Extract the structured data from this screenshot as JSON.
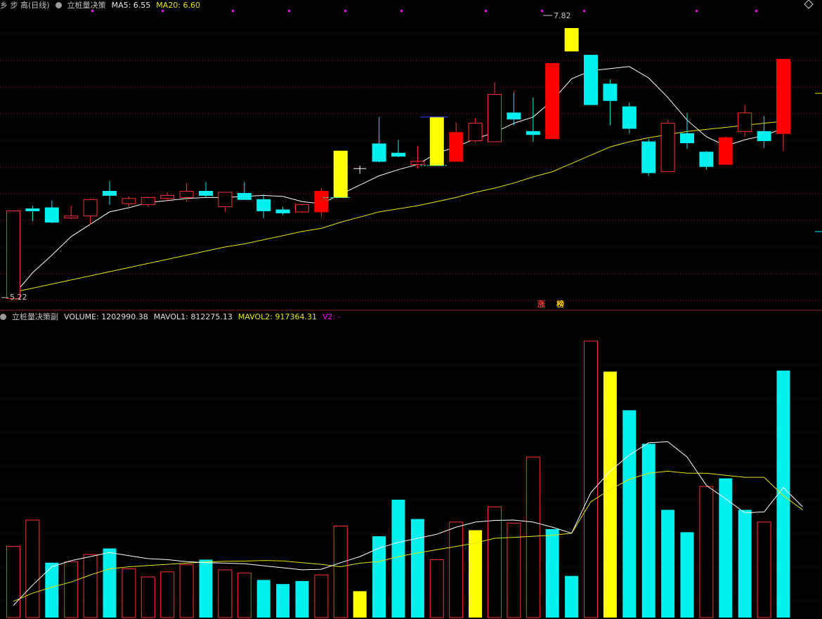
{
  "colors": {
    "background": "#000000",
    "grid": "#8b1a1a",
    "up": "#ff3232",
    "up_fill": "#ff0000",
    "down": "#00f0f0",
    "signal": "#ffff00",
    "ma5": "#ffffff",
    "ma20": "#e6e600",
    "v2": "#ff00ff",
    "header_text": "#c0c0c0",
    "zhang_text": "#ff3333",
    "bang_text": "#ffcc00"
  },
  "header_top": {
    "prefix": "乡 步 高(日线)",
    "indicator": "立桩量决策",
    "ma5_label": "MA5: 6.55",
    "ma20_label": "MA20: 6.60"
  },
  "header_bottom": {
    "indicator": "立桩量决策副",
    "volume_label": "VOLUME: 1202990.38",
    "mavol1_label": "MAVOL1: 812275.13",
    "mavol2_label": "MAVOL2: 917364.31",
    "v2_label": "V2: -"
  },
  "markers": {
    "zhang": "涨",
    "bang": "榜",
    "high_label": "7.82",
    "low_label": "5.22"
  },
  "chart_data": [
    {
      "type": "candlestick",
      "title": "立桩量决策",
      "series_note": "daily OHLC, price axis range approx 5.1 to 8.0",
      "ylim": [
        5.1,
        8.0
      ],
      "candles": [
        {
          "o": 5.2,
          "h": 6.05,
          "l": 5.22,
          "c": 6.05,
          "k": "up"
        },
        {
          "o": 6.07,
          "h": 6.1,
          "l": 5.95,
          "c": 6.05,
          "k": "down"
        },
        {
          "o": 6.08,
          "h": 6.15,
          "l": 5.93,
          "c": 5.94,
          "k": "down"
        },
        {
          "o": 5.98,
          "h": 6.1,
          "l": 5.97,
          "c": 6.0,
          "k": "up"
        },
        {
          "o": 6.0,
          "h": 6.17,
          "l": 5.92,
          "c": 6.16,
          "k": "up"
        },
        {
          "o": 6.2,
          "h": 6.34,
          "l": 6.11,
          "c": 6.24,
          "k": "down"
        },
        {
          "o": 6.12,
          "h": 6.19,
          "l": 6.09,
          "c": 6.17,
          "k": "up"
        },
        {
          "o": 6.11,
          "h": 6.19,
          "l": 6.09,
          "c": 6.18,
          "k": "up"
        },
        {
          "o": 6.17,
          "h": 6.23,
          "l": 6.14,
          "c": 6.2,
          "k": "up"
        },
        {
          "o": 6.18,
          "h": 6.32,
          "l": 6.14,
          "c": 6.24,
          "k": "up"
        },
        {
          "o": 6.24,
          "h": 6.33,
          "l": 6.18,
          "c": 6.2,
          "k": "down"
        },
        {
          "o": 6.09,
          "h": 6.22,
          "l": 6.04,
          "c": 6.23,
          "k": "up"
        },
        {
          "o": 6.22,
          "h": 6.33,
          "l": 6.18,
          "c": 6.16,
          "k": "down"
        },
        {
          "o": 6.16,
          "h": 6.21,
          "l": 5.98,
          "c": 6.05,
          "k": "down"
        },
        {
          "o": 6.06,
          "h": 6.09,
          "l": 6.01,
          "c": 6.03,
          "k": "down"
        },
        {
          "o": 6.04,
          "h": 6.12,
          "l": 6.03,
          "c": 6.11,
          "k": "up"
        },
        {
          "o": 6.04,
          "h": 6.27,
          "l": 5.99,
          "c": 6.24,
          "k": "upfill"
        },
        {
          "o": 6.18,
          "h": 6.63,
          "l": 6.18,
          "c": 6.63,
          "k": "signal"
        },
        {
          "o": 6.46,
          "h": 6.49,
          "l": 6.41,
          "c": 6.46,
          "k": "cross"
        },
        {
          "o": 6.7,
          "h": 6.96,
          "l": 6.52,
          "c": 6.53,
          "k": "down"
        },
        {
          "o": 6.61,
          "h": 6.74,
          "l": 6.57,
          "c": 6.58,
          "k": "down"
        },
        {
          "o": 6.5,
          "h": 6.68,
          "l": 6.46,
          "c": 6.53,
          "k": "up"
        },
        {
          "o": 6.49,
          "h": 6.96,
          "l": 6.49,
          "c": 6.96,
          "k": "signal"
        },
        {
          "o": 6.53,
          "h": 6.91,
          "l": 6.53,
          "c": 6.81,
          "k": "upfill"
        },
        {
          "o": 6.73,
          "h": 6.95,
          "l": 6.71,
          "c": 6.9,
          "k": "up"
        },
        {
          "o": 6.72,
          "h": 7.3,
          "l": 6.72,
          "c": 7.18,
          "k": "up"
        },
        {
          "o": 7.0,
          "h": 7.2,
          "l": 6.88,
          "c": 6.94,
          "k": "down"
        },
        {
          "o": 6.82,
          "h": 7.15,
          "l": 6.72,
          "c": 6.79,
          "k": "down"
        },
        {
          "o": 6.75,
          "h": 7.48,
          "l": 6.75,
          "c": 7.48,
          "k": "upfill"
        },
        {
          "o": 7.6,
          "h": 7.82,
          "l": 7.6,
          "c": 7.82,
          "k": "signal"
        },
        {
          "o": 7.56,
          "h": 7.56,
          "l": 7.08,
          "c": 7.08,
          "k": "down"
        },
        {
          "o": 7.28,
          "h": 7.32,
          "l": 6.88,
          "c": 7.12,
          "k": "down"
        },
        {
          "o": 7.06,
          "h": 7.1,
          "l": 6.8,
          "c": 6.85,
          "k": "down"
        },
        {
          "o": 6.72,
          "h": 6.75,
          "l": 6.39,
          "c": 6.42,
          "k": "down"
        },
        {
          "o": 6.43,
          "h": 6.93,
          "l": 6.43,
          "c": 6.9,
          "k": "up"
        },
        {
          "o": 6.8,
          "h": 7.0,
          "l": 6.65,
          "c": 6.71,
          "k": "down"
        },
        {
          "o": 6.62,
          "h": 6.63,
          "l": 6.45,
          "c": 6.48,
          "k": "down"
        },
        {
          "o": 6.5,
          "h": 6.77,
          "l": 6.5,
          "c": 6.76,
          "k": "upfill"
        },
        {
          "o": 6.82,
          "h": 7.08,
          "l": 6.77,
          "c": 7.0,
          "k": "up"
        },
        {
          "o": 6.82,
          "h": 6.97,
          "l": 6.66,
          "c": 6.73,
          "k": "down"
        },
        {
          "o": 6.8,
          "h": 7.52,
          "l": 6.63,
          "c": 7.52,
          "k": "upfill"
        }
      ],
      "ma5": [
        5.23,
        5.45,
        5.62,
        5.8,
        5.92,
        6.04,
        6.08,
        6.13,
        6.15,
        6.17,
        6.18,
        6.18,
        6.19,
        6.2,
        6.19,
        6.14,
        6.12,
        6.21,
        6.3,
        6.39,
        6.45,
        6.5,
        6.61,
        6.67,
        6.75,
        6.81,
        6.9,
        6.96,
        7.12,
        7.33,
        7.41,
        7.43,
        7.45,
        7.34,
        7.15,
        6.93,
        6.77,
        6.68,
        6.74,
        6.78,
        6.85
      ],
      "ma20": [
        5.26,
        5.3,
        5.34,
        5.38,
        5.42,
        5.46,
        5.5,
        5.54,
        5.58,
        5.62,
        5.66,
        5.7,
        5.73,
        5.77,
        5.81,
        5.85,
        5.88,
        5.94,
        5.99,
        6.04,
        6.07,
        6.1,
        6.14,
        6.18,
        6.23,
        6.27,
        6.32,
        6.38,
        6.43,
        6.51,
        6.59,
        6.67,
        6.72,
        6.76,
        6.79,
        6.82,
        6.84,
        6.86,
        6.88,
        6.9,
        6.92
      ]
    },
    {
      "type": "bar",
      "title": "立桩量决策副",
      "ylim": [
        0,
        1450000
      ],
      "values": [
        350000,
        480000,
        270000,
        275000,
        310000,
        340000,
        240000,
        200000,
        225000,
        260000,
        285000,
        235000,
        220000,
        185000,
        165000,
        180000,
        210000,
        450000,
        130000,
        400000,
        580000,
        485000,
        285000,
        470000,
        430000,
        545000,
        465000,
        790000,
        435000,
        205000,
        1360000,
        1210000,
        1020000,
        855000,
        530000,
        420000,
        645000,
        685000,
        530000,
        470000,
        1215000
      ],
      "kinds": [
        "up",
        "up",
        "down",
        "up",
        "up",
        "down",
        "up",
        "up",
        "up",
        "up",
        "down",
        "up",
        "up",
        "down",
        "down",
        "down",
        "up",
        "up",
        "signal",
        "down",
        "down",
        "down",
        "up",
        "up",
        "signal",
        "up",
        "up",
        "up",
        "down",
        "down",
        "up",
        "signal",
        "down",
        "down",
        "down",
        "down",
        "up",
        "down",
        "down",
        "up",
        "down",
        "up"
      ],
      "mavol1": [
        60000,
        160000,
        250000,
        280000,
        300000,
        320000,
        305000,
        290000,
        285000,
        275000,
        270000,
        268000,
        265000,
        255000,
        245000,
        235000,
        238000,
        270000,
        300000,
        342000,
        370000,
        390000,
        410000,
        445000,
        470000,
        478000,
        480000,
        470000,
        445000,
        415000,
        615000,
        720000,
        800000,
        860000,
        865000,
        790000,
        650000,
        585000,
        515000,
        520000,
        640000,
        545000
      ],
      "mavol2": [
        80000,
        120000,
        150000,
        175000,
        210000,
        240000,
        250000,
        256000,
        262000,
        268000,
        273000,
        277000,
        278000,
        281000,
        279000,
        270000,
        262000,
        250000,
        268000,
        276000,
        300000,
        318000,
        334000,
        350000,
        367000,
        390000,
        395000,
        400000,
        405000,
        415000,
        570000,
        630000,
        680000,
        710000,
        720000,
        710000,
        710000,
        700000,
        690000,
        690000,
        600000,
        530000
      ]
    }
  ]
}
